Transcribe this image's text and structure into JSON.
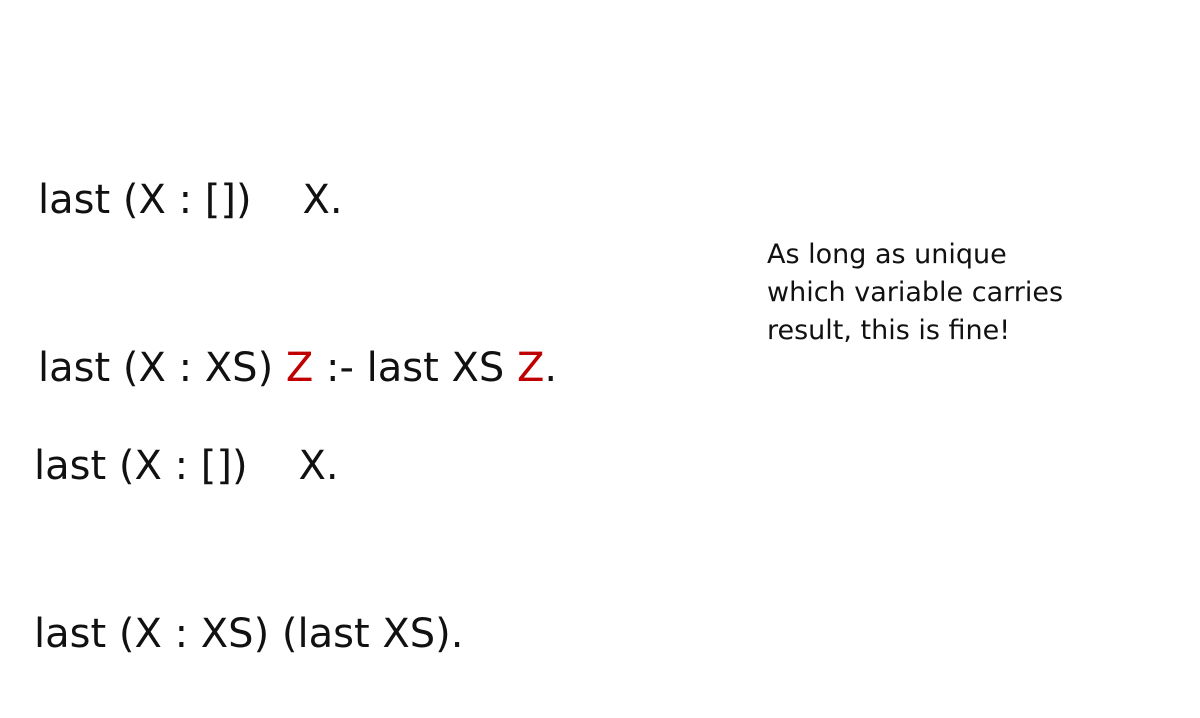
{
  "top_block": {
    "line1": "last (X : [])    X.",
    "line2_prefix": "last (X : XS) ",
    "line2_var1": "Z",
    "line2_middle": " :- last XS ",
    "line2_var2": "Z",
    "line2_suffix": "."
  },
  "bottom_block": {
    "line1": "last (X : [])    X.",
    "line2": "last (X : XS) (last XS)."
  },
  "note": {
    "line1": "As long as unique",
    "line2": "which variable carries",
    "line3": "result, this is fine!"
  },
  "colors": {
    "text": "#111111",
    "highlight": "#c00000",
    "background": "#ffffff"
  }
}
